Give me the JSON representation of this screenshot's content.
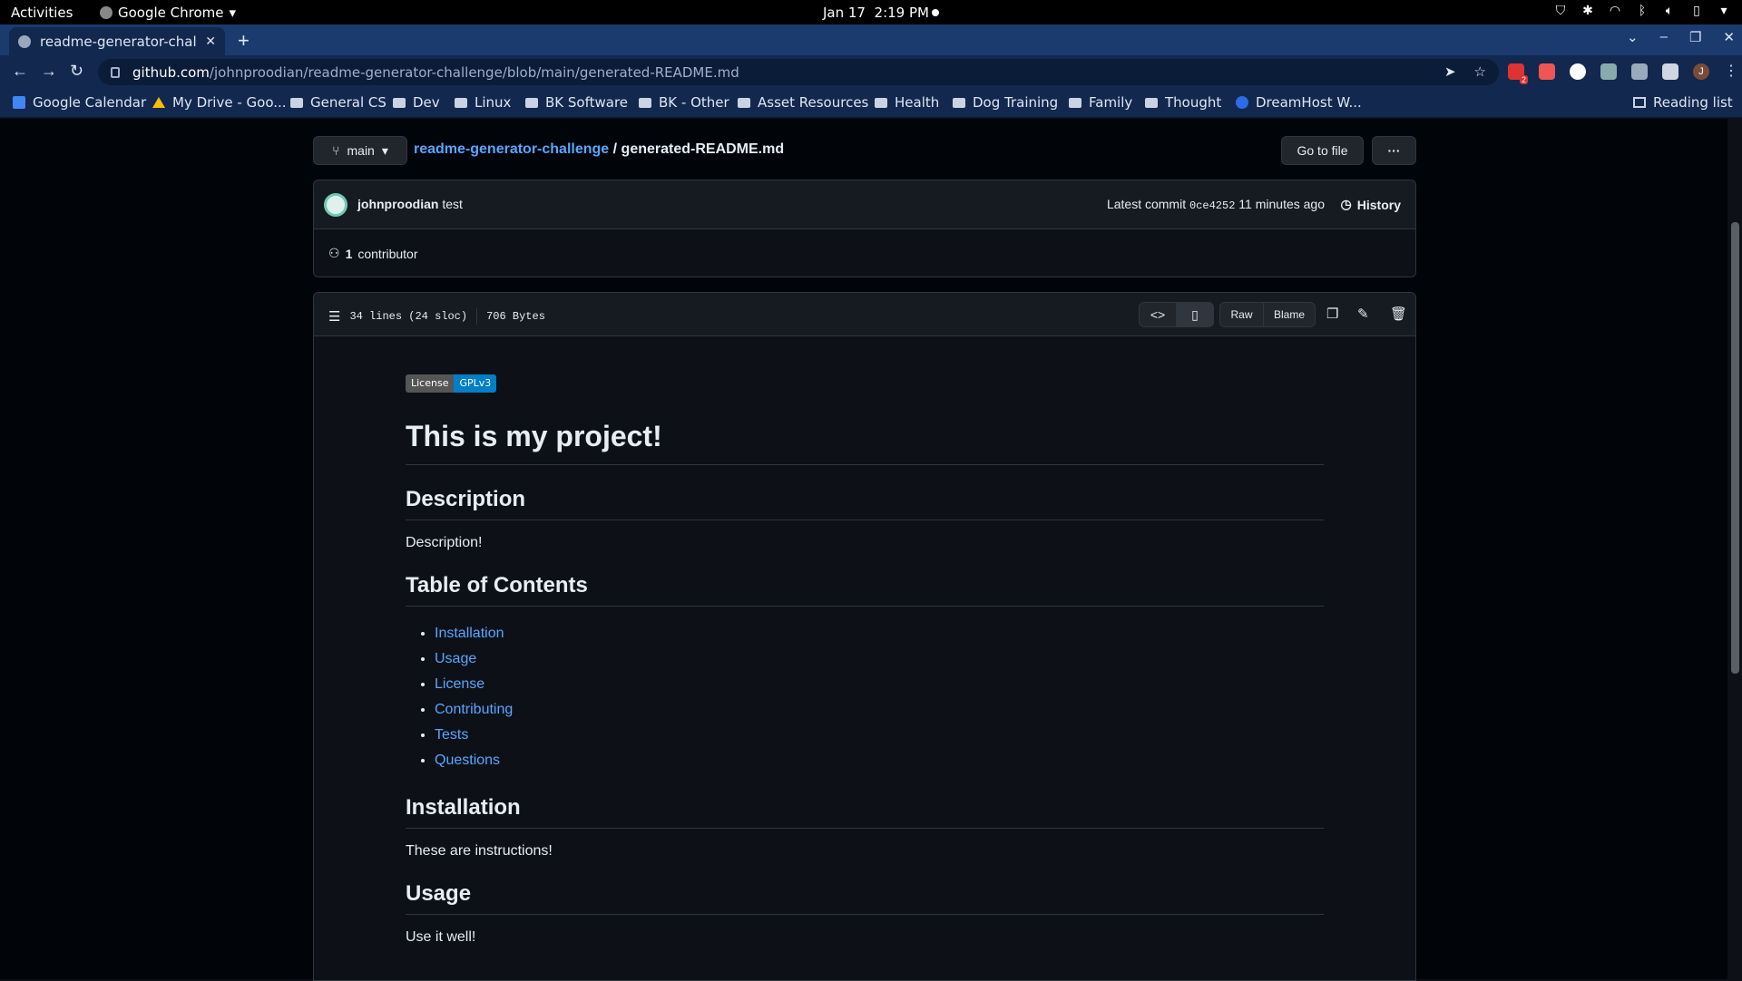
{
  "system": {
    "activities": "Activities",
    "app_name": "Google Chrome",
    "date": "Jan 17",
    "time": "2:19 PM"
  },
  "browser": {
    "tab_title": "readme-generator-challe",
    "url_host": "github.com",
    "url_path": "/johnproodian/readme-generator-challenge/blob/main/generated-README.md",
    "bookmarks": [
      "Google Calendar",
      "My Drive - Goo...",
      "General CS",
      "Dev",
      "Linux",
      "BK Software",
      "BK - Other",
      "Asset Resources",
      "Health",
      "Dog Training",
      "Family",
      "Thought",
      "DreamHost W..."
    ],
    "reading_list": "Reading list",
    "extension_badge": "2",
    "profile_initial": "J"
  },
  "repo": {
    "branch": "main",
    "repo_name": "readme-generator-challenge",
    "separator": "/",
    "file_name": "generated-README.md",
    "go_to_file": "Go to file",
    "more": "···"
  },
  "commit": {
    "author": "johnproodian",
    "message": "test",
    "latest_label": "Latest commit",
    "sha": "0ce4252",
    "age": "11 minutes ago",
    "history": "History",
    "contributors_count": "1",
    "contributors_label": "contributor"
  },
  "file": {
    "lines": "34 lines (24 sloc)",
    "size": "706 Bytes",
    "raw": "Raw",
    "blame": "Blame"
  },
  "readme": {
    "badge_left": "License",
    "badge_right": "GPLv3",
    "title": "This is my project!",
    "h_description": "Description",
    "description": "Description!",
    "h_toc": "Table of Contents",
    "toc": [
      "Installation",
      "Usage",
      "License",
      "Contributing",
      "Tests",
      "Questions"
    ],
    "h_installation": "Installation",
    "installation": "These are instructions!",
    "h_usage": "Usage",
    "usage": "Use it well!"
  },
  "colors": {
    "link": "#58a6ff",
    "page_bg": "#010409",
    "box_bg": "#0d1117",
    "border": "#30363d",
    "badge_blue": "#007ec6"
  }
}
